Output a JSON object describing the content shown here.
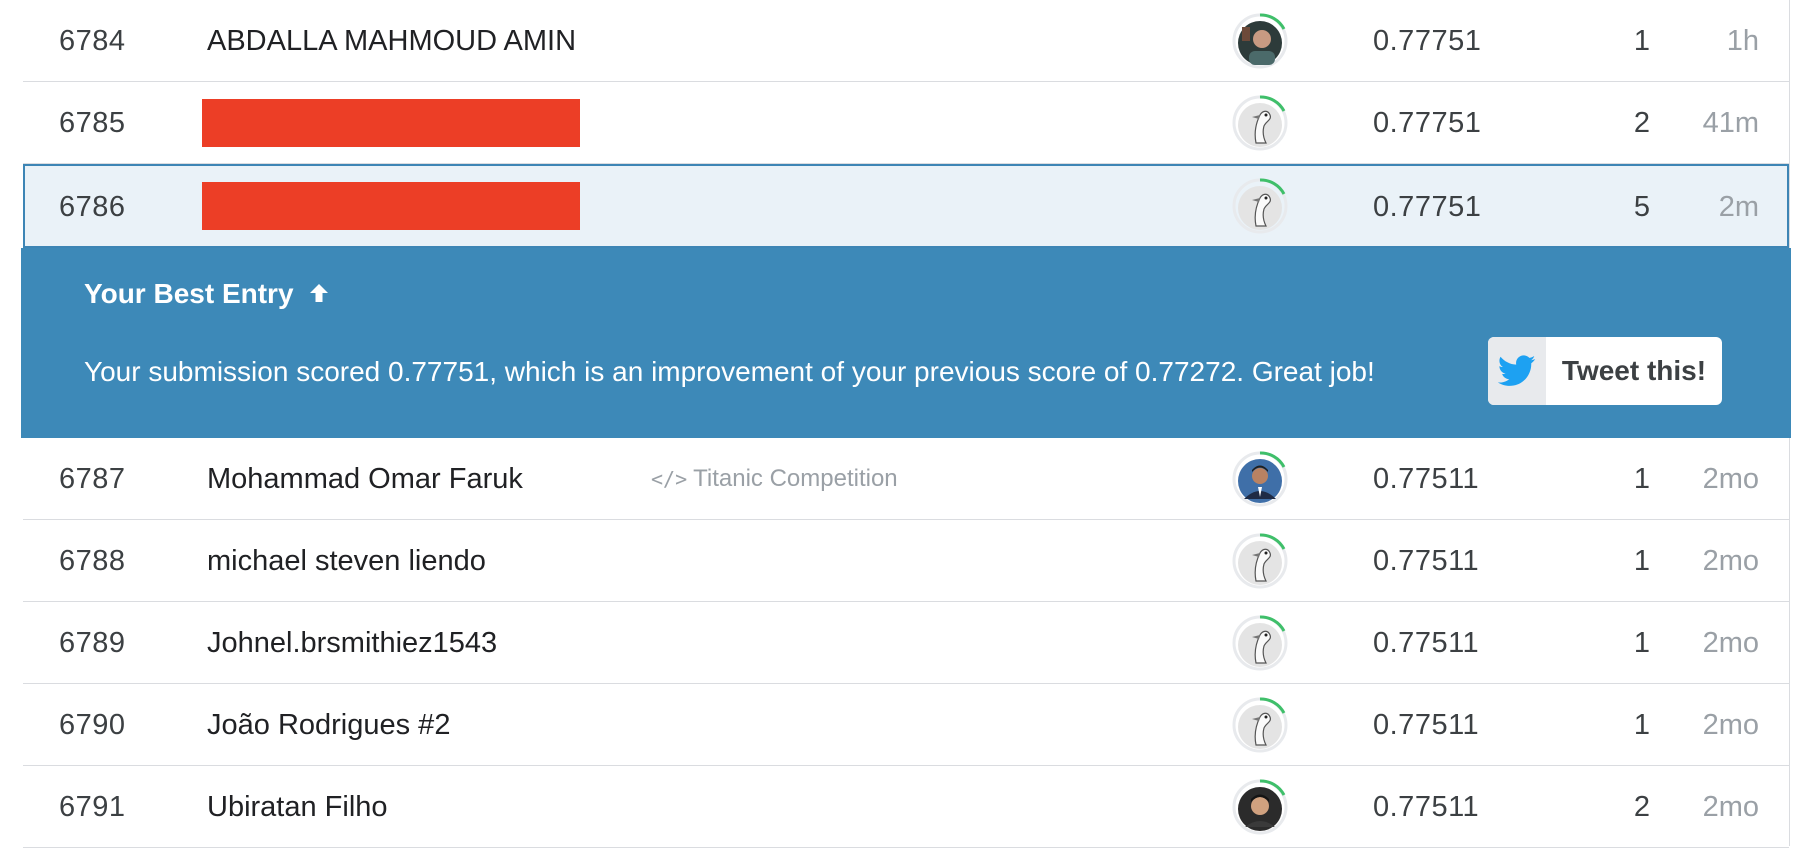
{
  "rows_before": [
    {
      "rank": "6784",
      "name": "ABDALLA MAHMOUD AMIN",
      "redacted": false,
      "avatar": "user-photo",
      "score": "0.77751",
      "entries": "1",
      "last": "1h"
    },
    {
      "rank": "6785",
      "name": "",
      "redacted": true,
      "avatar": "default-goose",
      "score": "0.77751",
      "entries": "2",
      "last": "41m"
    }
  ],
  "current_row": {
    "rank": "6786",
    "name": "",
    "redacted": true,
    "avatar": "default-goose",
    "score": "0.77751",
    "entries": "5",
    "last": "2m"
  },
  "best_entry": {
    "title": "Your Best Entry",
    "arrow": "🡑",
    "message": "Your submission scored 0.77751, which is an improvement of your previous score of 0.77272. Great job!",
    "tweet_label": "Tweet this!"
  },
  "rows_after": [
    {
      "rank": "6787",
      "name": "Mohammad Omar Faruk",
      "notebook": "Titanic Competition",
      "avatar": "user-photo",
      "score": "0.77511",
      "entries": "1",
      "last": "2mo"
    },
    {
      "rank": "6788",
      "name": "michael steven liendo",
      "avatar": "default-goose",
      "score": "0.77511",
      "entries": "1",
      "last": "2mo"
    },
    {
      "rank": "6789",
      "name": "Johnel.brsmithiez1543",
      "avatar": "default-goose",
      "score": "0.77511",
      "entries": "1",
      "last": "2mo"
    },
    {
      "rank": "6790",
      "name": "João Rodrigues #2",
      "avatar": "default-goose",
      "score": "0.77511",
      "entries": "1",
      "last": "2mo"
    },
    {
      "rank": "6791",
      "name": "Ubiratan Filho",
      "avatar": "user-photo",
      "score": "0.77511",
      "entries": "2",
      "last": "2mo"
    }
  ],
  "colors": {
    "panel": "#3d89b8",
    "highlight_bg": "#eaf2f8",
    "highlight_border": "#3d85b5",
    "redaction": "#ec3e26",
    "tier_ring": "#3fbf6a",
    "twitter": "#1da1f2"
  }
}
